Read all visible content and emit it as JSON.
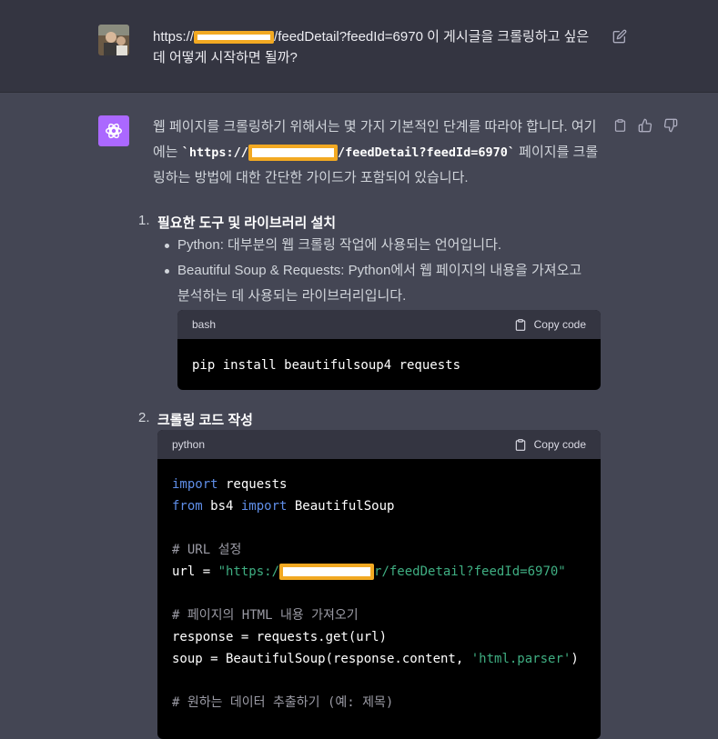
{
  "user_message": {
    "prefix": "https://",
    "suffix": "/feedDetail?feedId=6970",
    "question": " 이 게시글을 크롤링하고 싶은데 어떻게 시작하면 될까?"
  },
  "assistant": {
    "intro_part1": "웹 페이지를 크롤링하기 위해서는 몇 가지 기본적인 단계를 따라야 합니다. 여기에는 ",
    "intro_code_prefix": "`https://",
    "intro_code_suffix": "/feedDetail?feedId=6970`",
    "intro_part2": " 페이지를 크롤링하는 방법에 대한 간단한 가이드가 포함되어 있습니다.",
    "steps": [
      {
        "number": "1.",
        "title": "필요한 도구 및 라이브러리 설치",
        "bullets": [
          "Python: 대부분의 웹 크롤링 작업에 사용되는 언어입니다.",
          "Beautiful Soup & Requests: Python에서 웹 페이지의 내용을 가져오고",
          "분석하는 데 사용되는 라이브러리입니다."
        ],
        "code": {
          "language": "bash",
          "copy_label": "Copy code",
          "line1": "pip install beautifulsoup4 requests"
        }
      },
      {
        "number": "2.",
        "title": "크롤링 코드 작성",
        "code": {
          "language": "python",
          "copy_label": "Copy code",
          "l1_kw": "import",
          "l1_rest": " requests",
          "l2_kw1": "from",
          "l2_mid": " bs4 ",
          "l2_kw2": "import",
          "l2_rest": " BeautifulSoup",
          "l4_comment": "# URL 설정",
          "l5_a": "url = ",
          "l5_str_prefix": "\"https:/",
          "l5_str_suffix": "r/feedDetail?feedId=6970\"",
          "l7_comment": "# 페이지의 HTML 내용 가져오기",
          "l8": "response = requests.get(url)",
          "l9_a": "soup = BeautifulSoup(response.content, ",
          "l9_str": "'html.parser'",
          "l9_b": ")",
          "l11_comment": "# 원하는 데이터 추출하기 (예: 제목)"
        }
      }
    ]
  },
  "colors": {
    "user_bg": "#343541",
    "assistant_bg": "#444654",
    "bot_avatar": "#ab68ff",
    "redaction_border": "#f2a922",
    "code_keyword": "#5f8ee8",
    "code_string": "#3fae82"
  },
  "icons": [
    "user-avatar",
    "edit-icon",
    "openai-logo-icon",
    "clipboard-icon",
    "thumbs-up-icon",
    "thumbs-down-icon"
  ]
}
